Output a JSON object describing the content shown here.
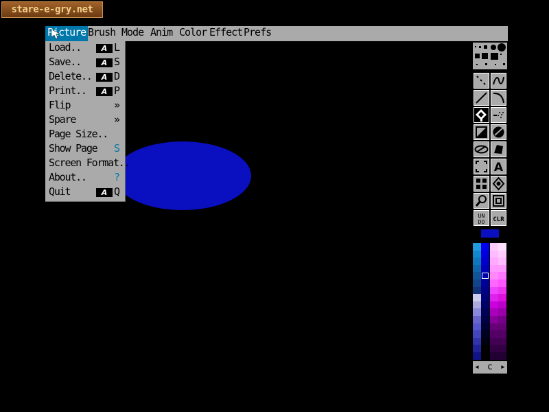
{
  "watermark": "stare-e-gry.net",
  "menubar": {
    "items": [
      "Picture",
      "Brush",
      "Mode",
      "Anim",
      "Color",
      "Effect",
      "Prefs"
    ],
    "active": "Picture"
  },
  "picture_menu": {
    "items": [
      {
        "label": "Load..",
        "shortcut": "L",
        "amiga_key": true
      },
      {
        "label": "Save..",
        "shortcut": "S",
        "amiga_key": true
      },
      {
        "label": "Delete..",
        "shortcut": "D",
        "amiga_key": true
      },
      {
        "label": "Print..",
        "shortcut": "P",
        "amiga_key": true
      },
      {
        "label": "Flip",
        "shortcut": "»",
        "amiga_key": false
      },
      {
        "label": "Spare",
        "shortcut": "»",
        "amiga_key": false
      },
      {
        "label": "Page Size..",
        "shortcut": "",
        "amiga_key": false
      },
      {
        "label": "Show Page",
        "shortcut": "S",
        "amiga_key": false
      },
      {
        "label": "Screen Format..",
        "shortcut": "",
        "amiga_key": false
      },
      {
        "label": "About..",
        "shortcut": "?",
        "amiga_key": false
      },
      {
        "label": "Quit",
        "shortcut": "Q",
        "amiga_key": true
      }
    ]
  },
  "amiga_key_glyph": "A",
  "toolbar": {
    "undo_label": "UNDO",
    "clr_label": "CLR",
    "text_tool_label": "A",
    "palette_arrow_left": "◂",
    "palette_arrow_right": "▸",
    "palette_label": "c"
  },
  "colors": {
    "menubar_bg": "#aaaaaa",
    "menu_highlight": "#0077aa",
    "foreground_color": "#0a0fbf",
    "ellipse": "#0a0fbf"
  }
}
